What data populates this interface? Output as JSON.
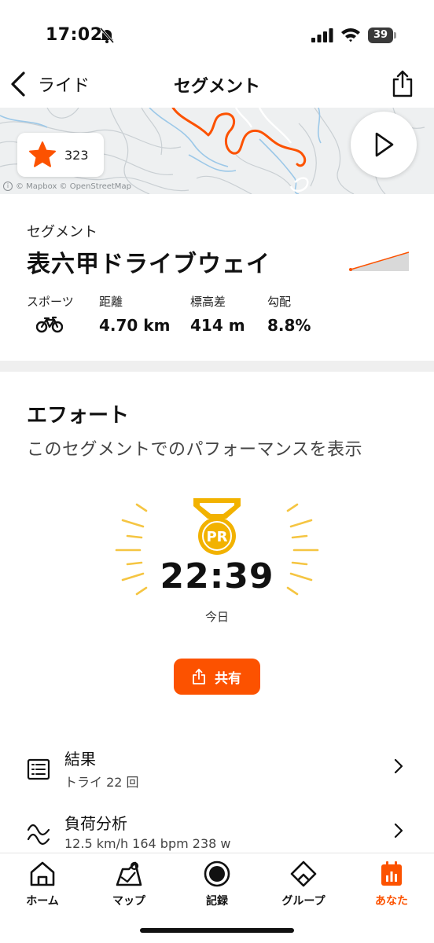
{
  "status_bar": {
    "time": "17:02",
    "battery": "39"
  },
  "nav": {
    "back_label": "ライド",
    "title": "セグメント"
  },
  "map": {
    "star_count": "323",
    "credit": "© Mapbox © OpenStreetMap"
  },
  "segment": {
    "kicker": "セグメント",
    "name": "表六甲ドライブウェイ",
    "stats": {
      "sport_label": "スポーツ",
      "distance_label": "距離",
      "distance_value": "4.70 km",
      "elevation_label": "標高差",
      "elevation_value": "414 m",
      "grade_label": "勾配",
      "grade_value": "8.8%"
    }
  },
  "effort": {
    "title": "エフォート",
    "subtitle": "このセグメントでのパフォーマンスを表示",
    "badge": "PR",
    "time": "22:39",
    "date": "今日",
    "share_label": "共有"
  },
  "list": [
    {
      "title": "結果",
      "subtitle": "トライ 22 回"
    },
    {
      "title": "負荷分析",
      "subtitle": "12.5 km/h 164 bpm 238 w"
    }
  ],
  "tabs": [
    {
      "label": "ホーム"
    },
    {
      "label": "マップ"
    },
    {
      "label": "記録"
    },
    {
      "label": "グループ"
    },
    {
      "label": "あなた"
    }
  ],
  "colors": {
    "accent": "#fc5200",
    "pr_gold": "#f2b200"
  }
}
